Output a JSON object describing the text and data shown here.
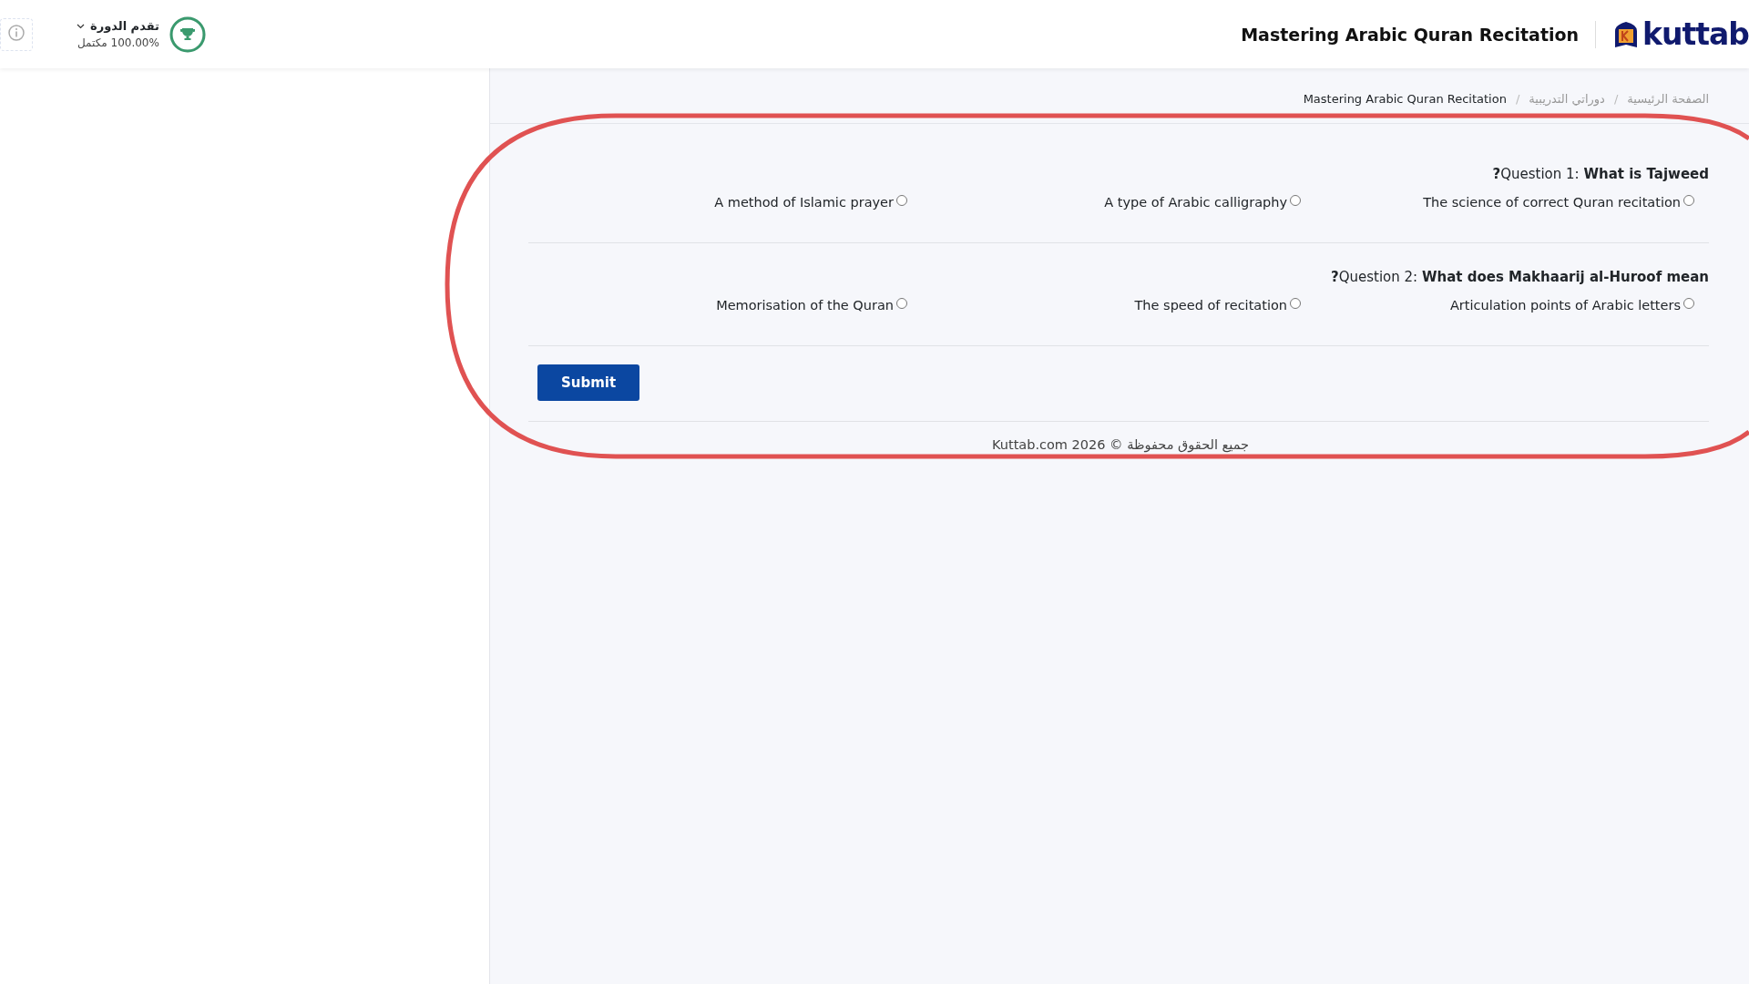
{
  "header": {
    "logo": "kuttab",
    "course_title": "Mastering Arabic Quran Recitation",
    "progress": {
      "label": "تقدم الدورة",
      "value": "100.00% مكتمل",
      "level": 1
    }
  },
  "breadcrumb": [
    {
      "kind": "current",
      "label": "Mastering Arabic Quran Recitation"
    },
    {
      "kind": "separator",
      "label": "/"
    },
    {
      "kind": "link",
      "label": "دوراتي التدريبية"
    },
    {
      "kind": "separator",
      "label": "/"
    },
    {
      "kind": "link",
      "label": "الصفحة الرئيسية"
    }
  ],
  "questions": [
    {
      "text": "**?**Question 1: **What is Tajweed**",
      "options": [
        {
          "label": "A method of Islamic prayer",
          "selected": false
        },
        {
          "label": "A type of Arabic calligraphy",
          "selected": false
        },
        {
          "label": "The science of correct Quran recitation",
          "selected": false
        }
      ]
    },
    {
      "text": "**?**Question 2: **What does Makhaarij al-Huroof mean**",
      "options": [
        {
          "label": "Memorisation of the Quran",
          "selected": false
        },
        {
          "label": "The speed of recitation",
          "selected": false
        },
        {
          "label": "Articulation points of Arabic letters",
          "selected": false
        }
      ]
    }
  ],
  "submit": "Submit",
  "footer": "جميع الحقوق محفوظة © 2026 Kuttab.com"
}
